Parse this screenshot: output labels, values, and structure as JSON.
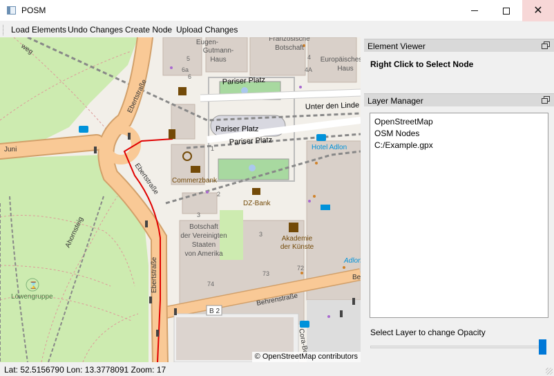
{
  "window": {
    "title": "POSM",
    "icon": "app-window-icon",
    "controls": {
      "minimize": "minimize-icon",
      "maximize": "maximize-icon",
      "close": "✕"
    }
  },
  "menu": {
    "items": [
      "Load Elements",
      "Undo Changes",
      "Create Node",
      "Upload Changes"
    ]
  },
  "map": {
    "attribution": "© OpenStreetMap contributors",
    "labels": {
      "eugen": [
        "Eugen-",
        "Gutmann-",
        "Haus"
      ],
      "franz": "Französische",
      "botschaft": "Botschaft",
      "europ": [
        "Europäisches",
        "Haus"
      ],
      "pariser_platz_top": "Pariser Platz",
      "pariser_platz_mid": "Pariser Platz",
      "pariser_platz_bot": "Pariser Platz",
      "unter_den_linden": "Unter den Linde",
      "hotel_adlon": "Hotel Adlon",
      "juni": "Juni",
      "ebertstrasse_a": "Ebertstraße",
      "ebertstrasse_b": "Ebertstraße",
      "ebertstrasse_c": "Ebertstraße",
      "commerzbank": "Commerzbank",
      "dz_bank": "DZ-Bank",
      "us_embassy": [
        "Botschaft",
        "der Vereinigten",
        "Staaten",
        "von Amerika"
      ],
      "akademie": [
        "Akademie",
        "der Künste"
      ],
      "ahornsteig": "Ahornsteig",
      "loewengruppe": "Löwengruppe",
      "behrenstrasse": "Behrenstraße",
      "b2": "B 2",
      "cora": "Cora-Be",
      "adlon_small": "Adlon",
      "be": "Be",
      "weg": "weg",
      "num_2": "2",
      "num_3": "3",
      "num_4": "4",
      "num_4a": "4A",
      "num_5": "5",
      "num_6a": "6a",
      "num_6": "6",
      "num_72": "72",
      "num_73": "73",
      "num_74": "74",
      "num_1": "1",
      "num_3b": "3"
    }
  },
  "element_viewer": {
    "title": "Element Viewer",
    "hint": "Right Click to Select Node"
  },
  "layer_manager": {
    "title": "Layer Manager",
    "layers": [
      "OpenStreetMap",
      "OSM Nodes",
      "C:/Example.gpx"
    ],
    "opacity_label": "Select Layer to change Opacity",
    "opacity_value": 1.0
  },
  "status": {
    "text": "Lat: 52.5156790 Lon: 13.3778091 Zoom: 17"
  },
  "colors": {
    "accent": "#0078d7",
    "route": "#e00000",
    "road_major": "#f9c996",
    "road_outline": "#d2a06a",
    "park": "#cdebb0",
    "forest": "#add19e",
    "building": "#d9d0c9"
  }
}
